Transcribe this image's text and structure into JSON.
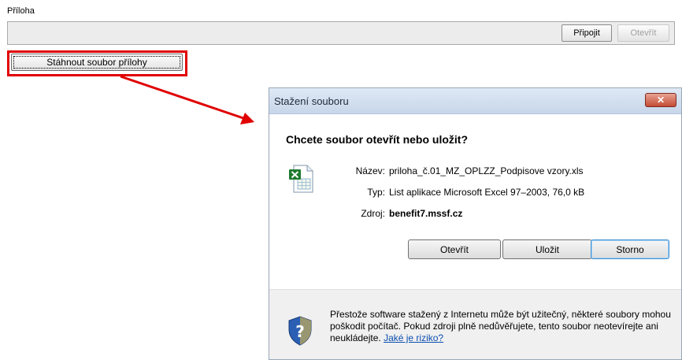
{
  "form": {
    "field_label": "Příloha",
    "attach_label": "Připojit",
    "open_label": "Otevřít",
    "download_label": "Stáhnout soubor přílohy"
  },
  "dialog": {
    "title": "Stažení souboru",
    "close_glyph": "✕",
    "question": "Chcete soubor otevřít nebo uložit?",
    "file": {
      "name_label": "Název:",
      "name_value": "priloha_č.01_MZ_OPLZZ_Podpisove vzory.xls",
      "type_label": "Typ:",
      "type_value": "List aplikace Microsoft Excel 97–2003, 76,0 kB",
      "source_label": "Zdroj:",
      "source_value": "benefit7.mssf.cz",
      "icon": "excel-file-icon"
    },
    "buttons": {
      "open": "Otevřít",
      "save": "Uložit",
      "cancel": "Storno"
    },
    "warning": {
      "text": "Přestože software stažený z Internetu může být užitečný, některé soubory mohou poškodit počítač. Pokud zdroji plně nedůvěřujete, tento soubor neotevírejte ani neukládejte. ",
      "link": "Jaké je riziko?",
      "icon": "shield-icon"
    }
  },
  "colors": {
    "highlight": "#e00000",
    "link": "#0b4fb0",
    "default_button_border": "#3c8dd1"
  }
}
